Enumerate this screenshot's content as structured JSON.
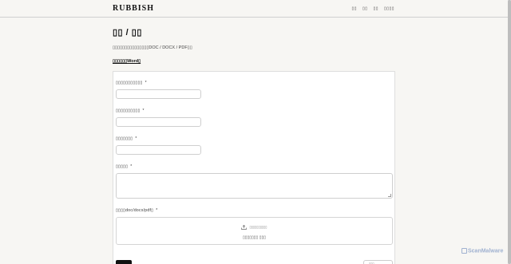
{
  "header": {
    "brand": "RUBBISH",
    "nav": [
      "▯▯",
      "▯▯",
      "▯▯",
      "▯▯▯▯"
    ]
  },
  "main": {
    "title": "▯▯ / ▯▯",
    "subtitle": "▯▯▯▯▯▯▯▯▯▯▯▯▯▯▯DOC / DOCX / PDF▯▯",
    "template_link": "▯▯▯▯▯▯Word▯"
  },
  "form": {
    "fields": [
      {
        "label": "▯▯▯▯▯▯▯▯▯▯▯",
        "value": ""
      },
      {
        "label": "▯▯▯▯▯▯▯▯▯▯",
        "value": ""
      },
      {
        "label": "▯▯▯▯▯▯▯",
        "value": ""
      }
    ],
    "textarea_label": "▯▯▯▯▯",
    "textarea_value": "",
    "file_label": "▯▯▯▯doc/docx/pdf▯",
    "required_mark": "*",
    "drop_hint": "▯▯▯▯▯▯▯▯▯▯",
    "drop_status": "▯▯▯▯▯▯▯ ▯▯▯",
    "submit_label": "",
    "cancel_label": "▯▯▯"
  },
  "watermark": "ScanMalware"
}
